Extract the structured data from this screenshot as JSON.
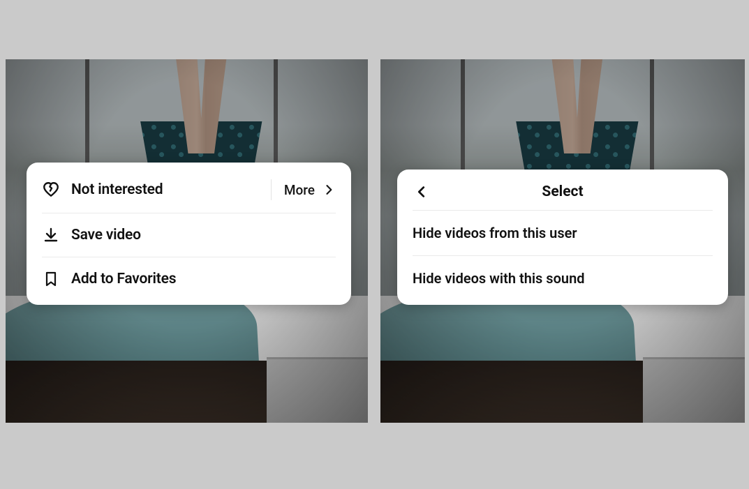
{
  "left_menu": {
    "not_interested": "Not interested",
    "more": "More",
    "save_video": "Save video",
    "add_favorites": "Add to Favorites"
  },
  "right_menu": {
    "title": "Select",
    "hide_user": "Hide videos from this user",
    "hide_sound": "Hide videos with this sound"
  }
}
